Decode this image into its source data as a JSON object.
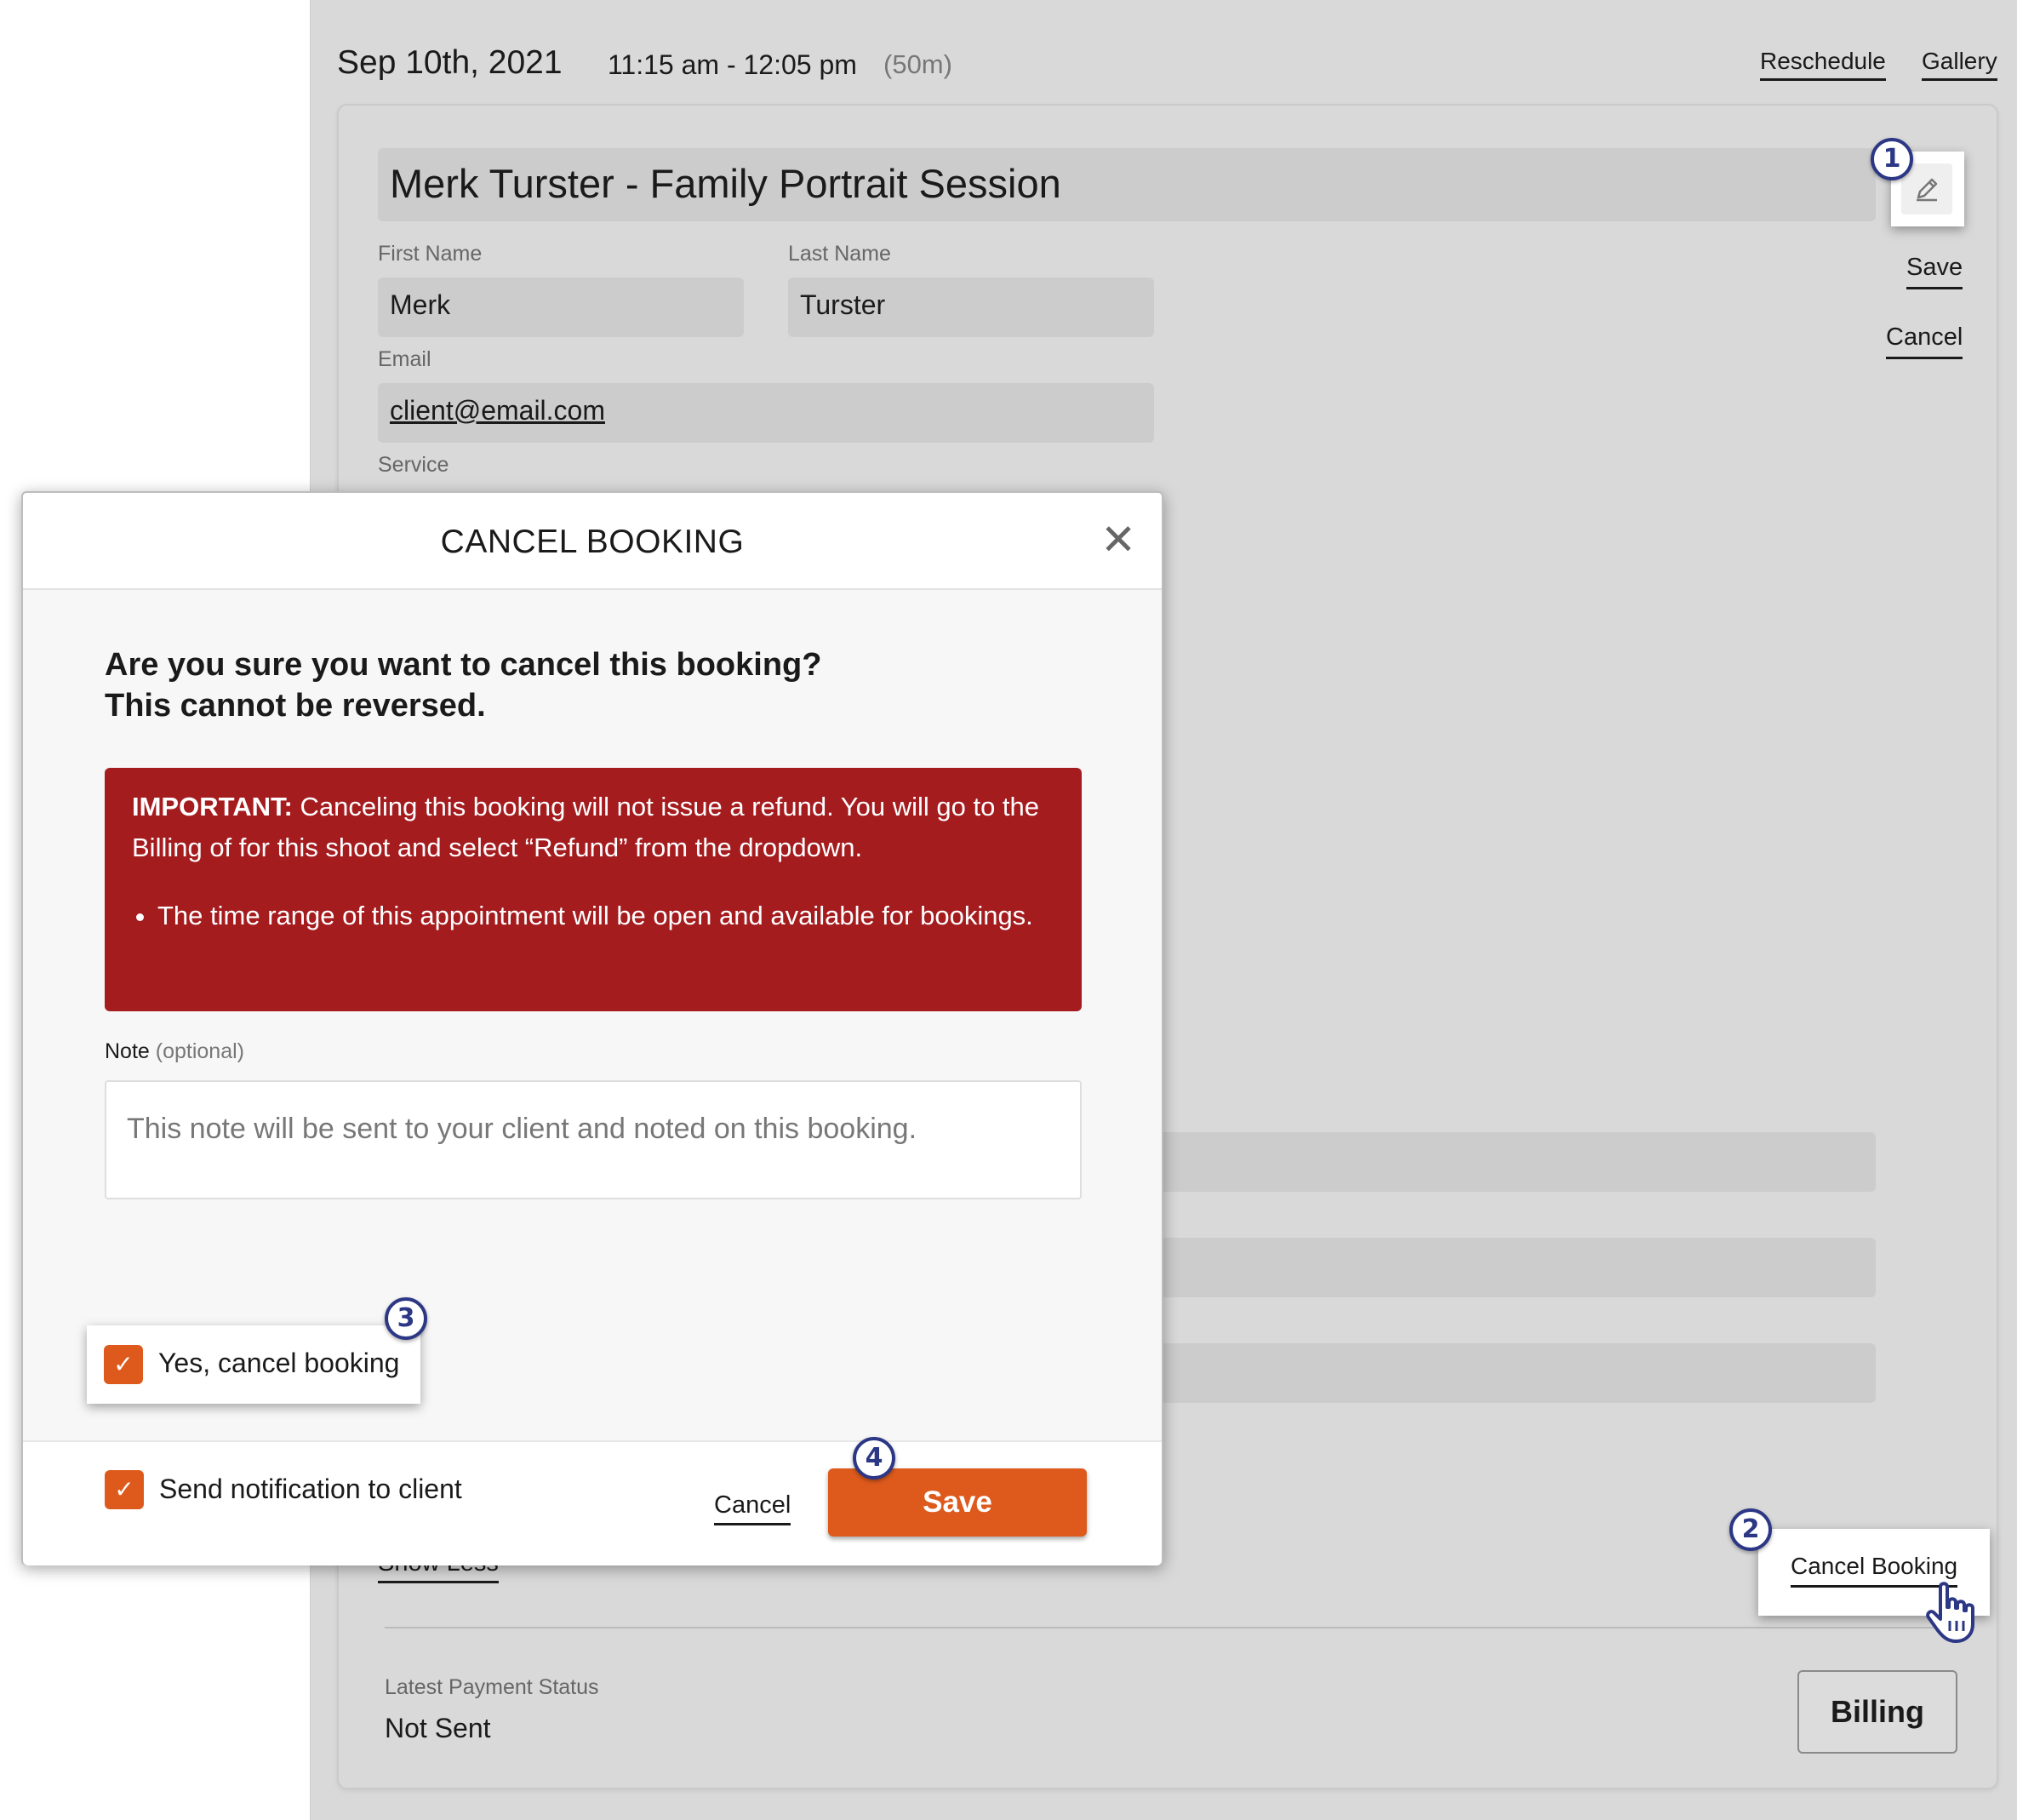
{
  "header": {
    "date": "Sep 10th, 2021",
    "time": "11:15 am - 12:05 pm",
    "duration": "(50m)",
    "reschedule": "Reschedule",
    "gallery": "Gallery"
  },
  "booking": {
    "title": "Merk Turster - Family Portrait Session",
    "first_name_label": "First Name",
    "first_name": "Merk",
    "last_name_label": "Last Name",
    "last_name": "Turster",
    "email_label": "Email",
    "email": "client@email.com",
    "service_label": "Service",
    "save": "Save",
    "cancel": "Cancel",
    "show_less": "Show Less",
    "cancel_booking": "Cancel Booking",
    "payment_label": "Latest Payment Status",
    "payment_status": "Not Sent",
    "billing": "Billing"
  },
  "steps": [
    "1",
    "2",
    "3",
    "4"
  ],
  "modal": {
    "title": "CANCEL BOOKING",
    "close": "✕",
    "question_line1": "Are you sure you want to cancel this booking?",
    "question_line2": "This cannot be reversed.",
    "warning_strong": "IMPORTANT:",
    "warning_text": " Canceling this booking will not issue a refund. You will go to the Billing of for this shoot and select “Refund” from the dropdown.",
    "warning_bullet": "The time range of this appointment will be open and available for bookings.",
    "note_label": "Note",
    "note_optional": "(optional)",
    "note_placeholder": "This note will be sent to your client and noted on this booking.",
    "confirm_label": "Yes, cancel booking",
    "confirm_checked": true,
    "notify_label": "Send notification to client",
    "notify_checked": true,
    "cancel": "Cancel",
    "save": "Save"
  },
  "colors": {
    "accent": "#dd5a1c",
    "warning": "#a51c1f",
    "badge": "#2c3785",
    "background": "#d9d9d9"
  },
  "icons": {
    "edit": "pencil-icon",
    "close": "close-icon",
    "check": "check-icon",
    "cursor": "hand-pointer-icon"
  }
}
